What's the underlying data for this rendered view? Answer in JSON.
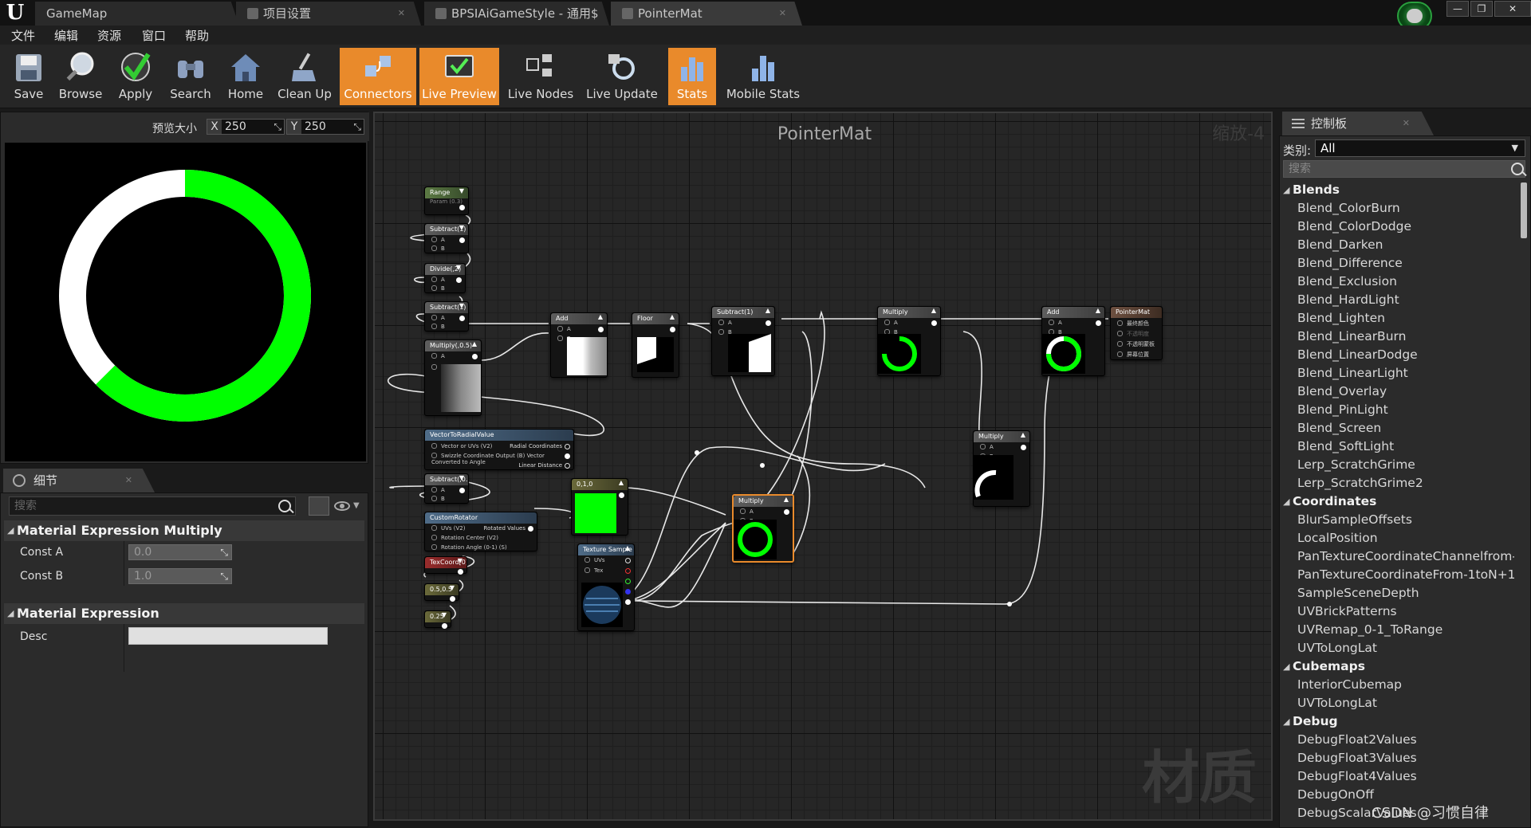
{
  "tabs": [
    {
      "label": "GameMap"
    },
    {
      "label": "项目设置"
    },
    {
      "label": "BPSIAiGameStyle - 通用$"
    },
    {
      "label": "PointerMat"
    }
  ],
  "menu": [
    "文件",
    "编辑",
    "资源",
    "窗口",
    "帮助"
  ],
  "toolbar": [
    {
      "label": "Save",
      "icon": "save-icon",
      "active": false
    },
    {
      "label": "Browse",
      "icon": "browse-icon",
      "active": false
    },
    {
      "label": "Apply",
      "icon": "apply-check-icon",
      "active": false
    },
    {
      "label": "Search",
      "icon": "binoculars-icon",
      "active": false
    },
    {
      "label": "Home",
      "icon": "home-icon",
      "active": false
    },
    {
      "label": "Clean Up",
      "icon": "broom-icon",
      "active": false
    },
    {
      "label": "Connectors",
      "icon": "connectors-icon",
      "active": true
    },
    {
      "label": "Live Preview",
      "icon": "live-preview-icon",
      "active": true
    },
    {
      "label": "Live Nodes",
      "icon": "live-nodes-icon",
      "active": false
    },
    {
      "label": "Live Update",
      "icon": "live-update-icon",
      "active": false
    },
    {
      "label": "Stats",
      "icon": "stats-icon",
      "active": true
    },
    {
      "label": "Mobile Stats",
      "icon": "mobile-stats-icon",
      "active": false
    }
  ],
  "preview": {
    "size_label": "预览大小",
    "x_axis": "X",
    "x_value": "250",
    "y_axis": "Y",
    "y_value": "250",
    "ring_fill_fraction": 0.625,
    "ring_color": "#00ff00"
  },
  "details": {
    "tab_label": "细节",
    "search_placeholder": "搜索",
    "section1": "Material Expression Multiply",
    "const_a_label": "Const A",
    "const_a_value": "0.0",
    "const_b_label": "Const B",
    "const_b_value": "1.0",
    "section2": "Material Expression",
    "desc_label": "Desc",
    "desc_value": ""
  },
  "graph": {
    "title": "PointerMat",
    "zoom": "缩放-4",
    "watermark": "材质",
    "nodes": {
      "range_title": "Range",
      "range_sub": "Param (0.3)",
      "subtract1_title": "Subtract(1)",
      "divide2_title": "Divide(,2)",
      "subtract1b_title": "Subtract(1)",
      "multiply05_title": "Multiply(,0.5)",
      "vtr_title": "VectorToRadialValue",
      "vtr_in1": "Vector or UVs (V2)",
      "vtr_in2": "Swizzle Coordinate Output (B) Vector Converted to Angle",
      "vtr_out1": "Radial Coordinates",
      "vtr_out3": "Linear Distance",
      "subtract05_title": "Subtract(,0.5)",
      "rotator_title": "CustomRotator",
      "rot_in1": "UVs (V2)",
      "rot_in2": "Rotation Center (V2)",
      "rot_in3": "Rotation Angle (0-1) (S)",
      "rot_out": "Rotated Values",
      "texcoord_title": "TexCoord[0]",
      "c05_title": "0.5,0.5",
      "c025_title": "0.25",
      "add1_title": "Add",
      "floor_title": "Floor",
      "subtract2_title": "Subtract(1)",
      "multiply1_title": "Multiply",
      "add2_title": "Add",
      "result_title": "PointerMat",
      "res_in1": "最终颜色",
      "res_in2": "不透明度",
      "res_in3": "不透明蒙板",
      "res_in4": "屏幕位置",
      "color_title": "0,1,0",
      "texture_title": "Texture Sample",
      "tex_uvs": "UVs",
      "tex_tex": "Tex",
      "multiply2_title": "Multiply",
      "multiply3_title": "Multiply",
      "pin_a": "A",
      "pin_b": "B"
    }
  },
  "palette": {
    "tab_label": "控制板",
    "category_label": "类别:",
    "category_value": "All",
    "search_placeholder": "搜索",
    "categories": [
      {
        "name": "Blends",
        "items": [
          "Blend_ColorBurn",
          "Blend_ColorDodge",
          "Blend_Darken",
          "Blend_Difference",
          "Blend_Exclusion",
          "Blend_HardLight",
          "Blend_Lighten",
          "Blend_LinearBurn",
          "Blend_LinearDodge",
          "Blend_LinearLight",
          "Blend_Overlay",
          "Blend_PinLight",
          "Blend_Screen",
          "Blend_SoftLight",
          "Lerp_ScratchGrime",
          "Lerp_ScratchGrime2"
        ]
      },
      {
        "name": "Coordinates",
        "items": [
          "BlurSampleOffsets",
          "LocalPosition",
          "PanTextureCoordinateChannelfrom-",
          "PanTextureCoordinateFrom-1toN+1",
          "SampleSceneDepth",
          "UVBrickPatterns",
          "UVRemap_0-1_ToRange",
          "UVToLongLat"
        ]
      },
      {
        "name": "Cubemaps",
        "items": [
          "InteriorCubemap",
          "UVToLongLat"
        ]
      },
      {
        "name": "Debug",
        "items": [
          "DebugFloat2Values",
          "DebugFloat3Values",
          "DebugFloat4Values",
          "DebugOnOff",
          "DebugScalarValues"
        ]
      }
    ]
  },
  "credit": "CSDN @习惯自律"
}
